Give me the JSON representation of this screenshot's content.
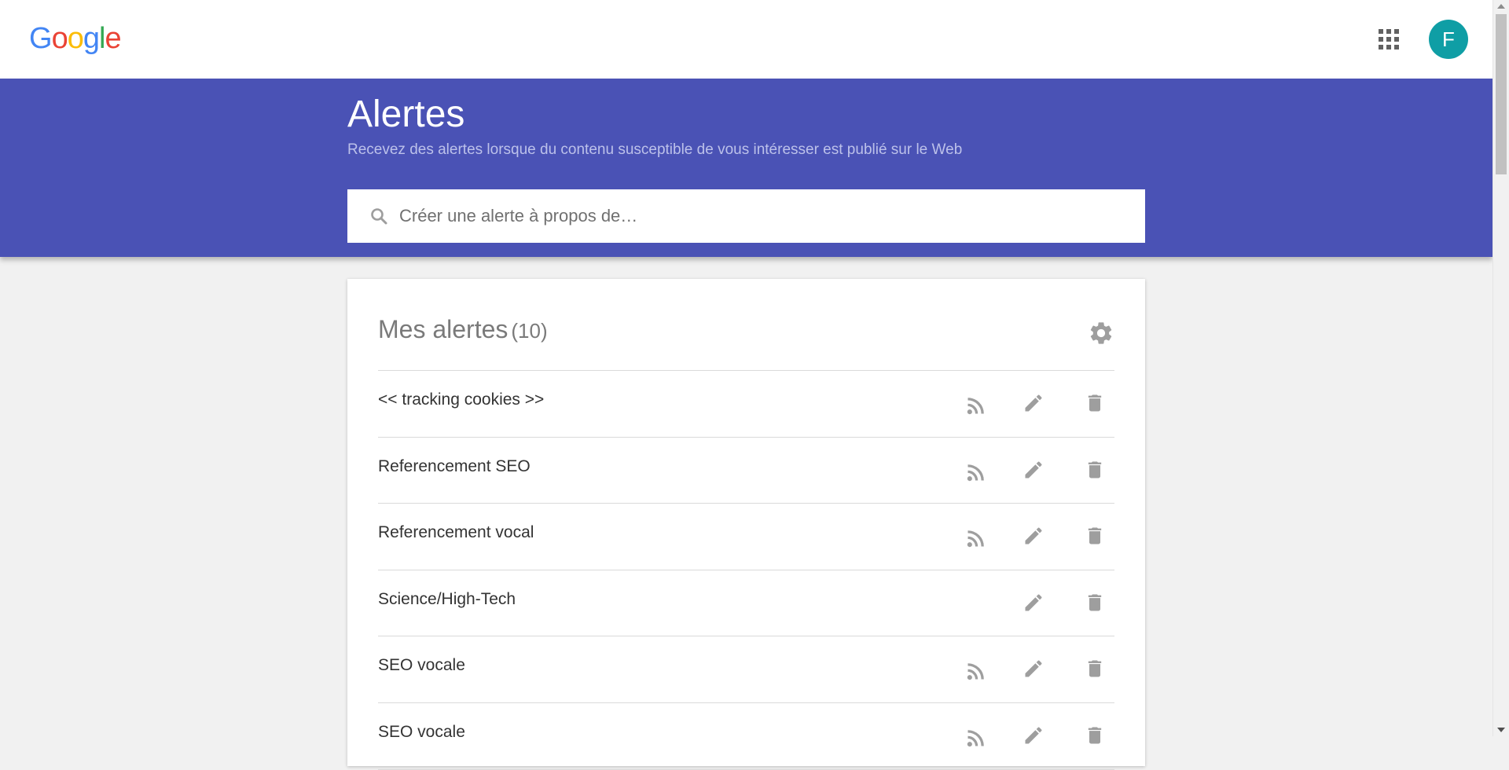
{
  "brand": {
    "logo_letters": [
      "G",
      "o",
      "o",
      "g",
      "l",
      "e"
    ],
    "colors": {
      "header_bg": "#4a52b5",
      "avatar_bg": "#0f9ea5",
      "icon_gray": "#9e9e9e"
    }
  },
  "topbar": {
    "apps_icon": "apps-grid-icon",
    "avatar_initial": "F"
  },
  "header": {
    "title": "Alertes",
    "subtitle": "Recevez des alertes lorsque du contenu susceptible de vous intéresser est publié sur le Web",
    "search": {
      "placeholder": "Créer une alerte à propos de…",
      "value": "",
      "icon": "search-icon"
    }
  },
  "alerts": {
    "title": "Mes alertes",
    "count": "(10)",
    "settings_icon": "gear-icon",
    "items": [
      {
        "name": "<< tracking cookies >>",
        "rss": true
      },
      {
        "name": "Referencement SEO",
        "rss": true
      },
      {
        "name": "Referencement vocal",
        "rss": true
      },
      {
        "name": "Science/High-Tech",
        "rss": false
      },
      {
        "name": "SEO vocale",
        "rss": true
      },
      {
        "name": "SEO vocale",
        "rss": true
      }
    ],
    "row_icons": {
      "rss": "rss-feed-icon",
      "edit": "pencil-icon",
      "delete": "trash-icon"
    }
  }
}
